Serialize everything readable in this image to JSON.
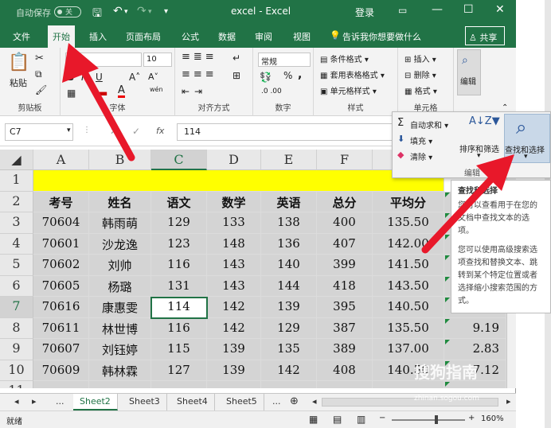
{
  "titlebar": {
    "autosave": "自动保存",
    "autosave_state": "关",
    "title": "excel  -  Excel",
    "login": "登录"
  },
  "tabs": [
    {
      "label": "文件"
    },
    {
      "label": "开始"
    },
    {
      "label": "插入"
    },
    {
      "label": "页面布局"
    },
    {
      "label": "公式"
    },
    {
      "label": "数据"
    },
    {
      "label": "审阅"
    },
    {
      "label": "视图"
    }
  ],
  "tellme": "告诉我你想要做什么",
  "share": "共享",
  "ribbon": {
    "clipboard": {
      "label": "剪贴板",
      "paste": "粘贴"
    },
    "font": {
      "label": "字体",
      "name": "宋体",
      "size": "10",
      "bold": "B",
      "italic": "I",
      "underline": "U",
      "color_a": "A",
      "wen": "wén"
    },
    "align": {
      "label": "对齐方式"
    },
    "number": {
      "label": "数字",
      "format": "常规",
      "percent": "%",
      "comma": ","
    },
    "styles": {
      "label": "样式",
      "cond": "条件格式",
      "table": "套用表格格式",
      "cell": "单元格样式"
    },
    "cells": {
      "label": "单元格",
      "insert": "插入",
      "delete": "删除",
      "format": "格式"
    },
    "editing": {
      "label": "编辑"
    }
  },
  "formula_bar": {
    "name_box": "C7",
    "fx": "fx",
    "value": "114"
  },
  "columns": [
    "A",
    "B",
    "C",
    "D",
    "E",
    "F"
  ],
  "rows": [
    "1",
    "2",
    "3",
    "4",
    "5",
    "6",
    "7",
    "8",
    "9",
    "10",
    "11"
  ],
  "header_row": [
    "考号",
    "姓名",
    "语文",
    "数学",
    "英语",
    "总分",
    "平均分"
  ],
  "table": [
    [
      "70604",
      "韩雨萌",
      "129",
      "133",
      "138",
      "400",
      "135.50"
    ],
    [
      "70601",
      "沙龙逸",
      "123",
      "148",
      "136",
      "407",
      "142.00"
    ],
    [
      "70602",
      "刘帅",
      "116",
      "143",
      "140",
      "399",
      "141.50"
    ],
    [
      "70605",
      "杨璐",
      "131",
      "143",
      "144",
      "418",
      "143.50"
    ],
    [
      "70616",
      "康惠雯",
      "114",
      "142",
      "139",
      "395",
      "140.50"
    ],
    [
      "70611",
      "林世博",
      "116",
      "142",
      "129",
      "387",
      "135.50"
    ],
    [
      "70607",
      "刘钰婷",
      "115",
      "139",
      "135",
      "389",
      "137.00"
    ],
    [
      "70609",
      "韩林霖",
      "127",
      "139",
      "142",
      "408",
      "140.50"
    ]
  ],
  "extra_col": [
    "9.19",
    "2.83",
    "7.12"
  ],
  "sheets": [
    {
      "label": "Sheet2"
    },
    {
      "label": "Sheet3"
    },
    {
      "label": "Sheet4"
    },
    {
      "label": "Sheet5"
    }
  ],
  "sheet_more": "...",
  "status": {
    "ready": "就绪",
    "zoom": "160%"
  },
  "edit_panel": {
    "autosum": "自动求和",
    "fill": "填充",
    "clear": "清除",
    "sort": "排序和筛选",
    "find": "查找和选择",
    "group": "编辑"
  },
  "tooltip": {
    "title": "查找和选择",
    "p1": "您可以查看用于在您的文档中查找文本的选项。",
    "p2": "您可以使用高级搜索选项查找和替换文本、跳转到某个特定位置或者选择缩小搜索范围的方式。"
  },
  "watermark": "搜狗指南",
  "watermark_url": "zhinan.sogou.com",
  "colors": {
    "excel_green": "#217346",
    "yellow": "#ffff00",
    "arrow_red": "#e8182a"
  }
}
